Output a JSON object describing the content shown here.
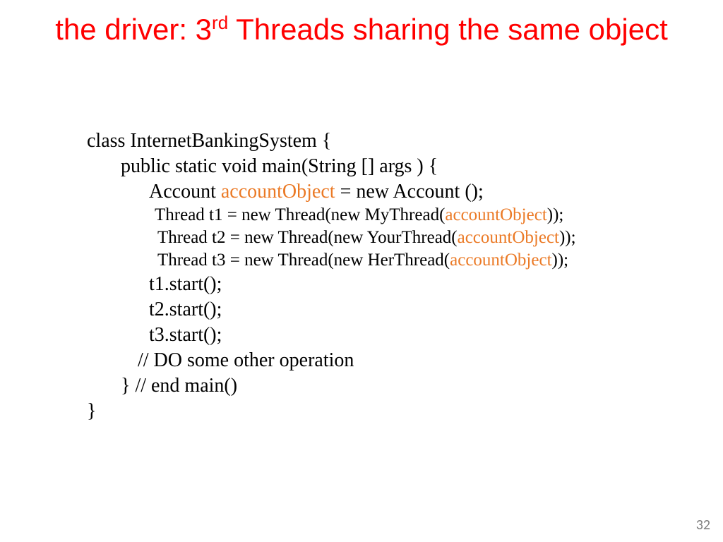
{
  "title": {
    "part1": "the driver: 3",
    "sup": "rd",
    "part2": " Threads sharing the same object"
  },
  "code": {
    "l1": "class InternetBankingSystem {",
    "l2": "public static void main(String [] args  ) {",
    "l3a": "Account ",
    "l3b": "accountObject",
    "l3c": " = new Account ();",
    "l4a": "Thread t1 = new Thread(new MyThread(",
    "l4b": "accountObject",
    "l4c": "));",
    "l5a": "Thread t2 = new Thread(new YourThread(",
    "l5b": "accountObject",
    "l5c": "));",
    "l6a": "Thread t3 = new Thread(new HerThread(",
    "l6b": "accountObject",
    "l6c": "));",
    "l7": "t1.start();",
    "l8": "t2.start();",
    "l9": "t3.start();",
    "l10": "// DO some other operation",
    "l11": "} // end main()",
    "l12": "}"
  },
  "page_number": "32"
}
